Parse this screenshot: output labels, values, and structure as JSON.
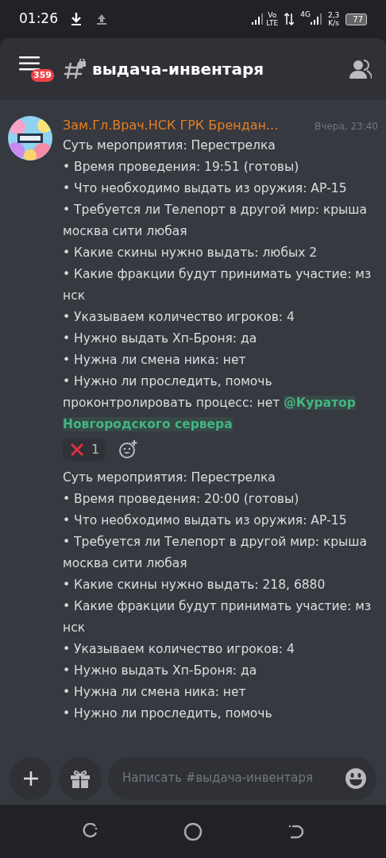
{
  "status_bar": {
    "time": "01:26",
    "network": [
      "Vo",
      "LTE",
      "4G"
    ],
    "speed": [
      "2,3",
      "K/s"
    ],
    "battery": "77"
  },
  "header": {
    "channel": "выдача-инвентаря",
    "unread_badge": "359"
  },
  "messages": [
    {
      "author": "Зам.Гл.Врач.НСК ГРК Брендан...",
      "time": "Вчера, 23:40",
      "lines": [
        {
          "text": "Суть мероприятия: Перестрелка"
        },
        {
          "text": "• Время проведения: 19:51 (готовы)"
        },
        {
          "text": "• Что необходимо выдать из оружия: АР-15"
        },
        {
          "text": "• Требуется ли Телепорт в другой мир: крыша москва сити любая"
        },
        {
          "text": "• Какие скины нужно выдать:  любых 2"
        },
        {
          "text": "• Какие фракции будут принимать участие: мз нск"
        },
        {
          "text": "• Указываем количество игроков: 4"
        },
        {
          "text": "• Нужно выдать Хп-Броня: да"
        },
        {
          "text": "• Нужна ли смена ника: нет"
        },
        {
          "text": "• Нужно ли проследить, помочь проконтролировать процесс: нет",
          "mention": [
            "@Куратор",
            "Новгородского сервера"
          ]
        }
      ],
      "reactions": [
        {
          "count": "1"
        }
      ]
    },
    {
      "lines": [
        {
          "text": "Суть мероприятия: Перестрелка"
        },
        {
          "text": "• Время проведения: 20:00 (готовы)"
        },
        {
          "text": "• Что необходимо выдать из оружия: АР-15"
        },
        {
          "text": "• Требуется ли Телепорт в другой мир: крыша москва сити любая"
        },
        {
          "text": "• Какие скины нужно выдать:  218, 6880"
        },
        {
          "text": "• Какие фракции будут принимать участие: мз нск"
        },
        {
          "text": "• Указываем количество игроков: 4"
        },
        {
          "text": "• Нужно выдать Хп-Броня: да"
        },
        {
          "text": "• Нужна ли смена ника: нет"
        },
        {
          "text": "• Нужно ли проследить, помочь"
        }
      ]
    }
  ],
  "composer": {
    "placeholder": "Написать #выдача-инвентаря"
  }
}
